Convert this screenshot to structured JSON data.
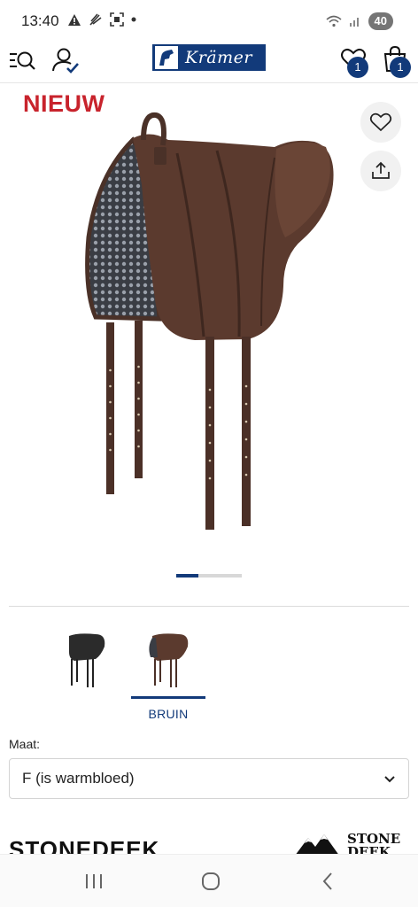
{
  "status_bar": {
    "time": "13:40",
    "battery": "40",
    "left_icons": [
      "warning-icon",
      "feather-icon",
      "scan-icon",
      "dot-icon"
    ],
    "right_icons": [
      "wifi-icon",
      "signal-icon"
    ]
  },
  "header": {
    "logo_text": "Krämer",
    "wishlist_count": "1",
    "cart_count": "1",
    "icons": [
      "menu-search-icon",
      "account-check-icon",
      "heart-icon",
      "bag-icon"
    ]
  },
  "product": {
    "badge": "NIEUW",
    "gallery": {
      "current_slide": 1,
      "total_slides": 3
    },
    "colors": {
      "accent": "#123a7a",
      "badge": "#c8232c",
      "saddle_brown": "#5b3a2e",
      "saddle_black": "#2b2b2b"
    },
    "variants": [
      {
        "label": "",
        "selected": false,
        "color": "#2b2b2b"
      },
      {
        "label": "BRUIN",
        "selected": true,
        "color": "#5b3a2e"
      }
    ],
    "size": {
      "label": "Maat:",
      "value": "F (is warmbloed)"
    }
  },
  "brand": {
    "heading": "STONEDEEK",
    "logo_line1": "STONE",
    "logo_line2": "DEEK"
  }
}
